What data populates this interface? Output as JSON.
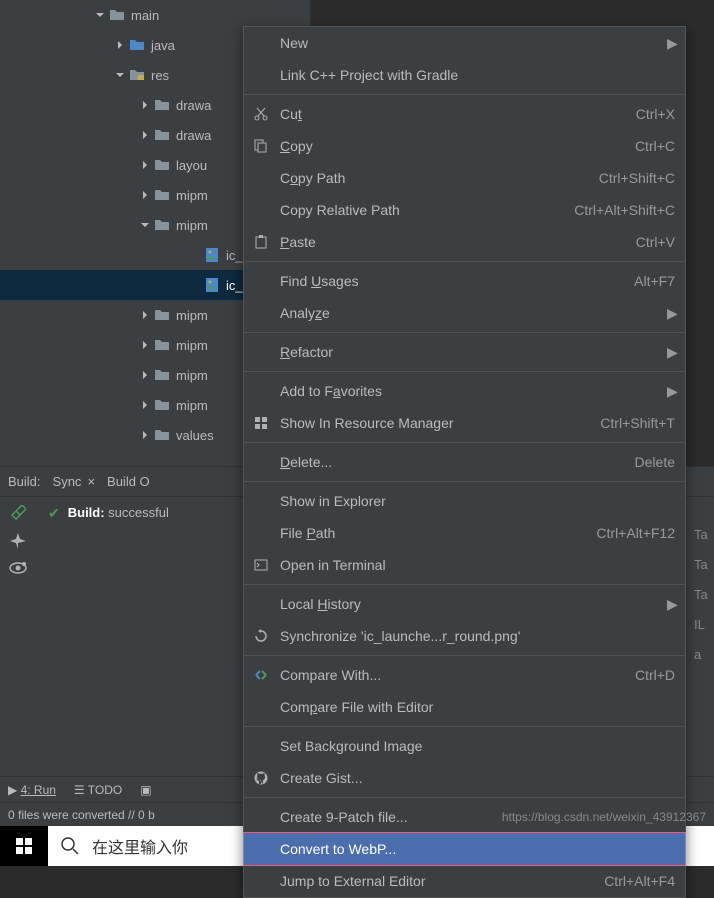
{
  "tree": {
    "items": [
      {
        "label": "main",
        "indent": "indent-1",
        "expanded": true,
        "type": "folder"
      },
      {
        "label": "java",
        "indent": "indent-2",
        "expanded": false,
        "type": "folder-blue"
      },
      {
        "label": "res",
        "indent": "indent-2",
        "expanded": true,
        "type": "folder-res"
      },
      {
        "label": "drawa",
        "indent": "indent-3",
        "expanded": false,
        "type": "folder"
      },
      {
        "label": "drawa",
        "indent": "indent-3",
        "expanded": false,
        "type": "folder"
      },
      {
        "label": "layou",
        "indent": "indent-3",
        "expanded": false,
        "type": "folder"
      },
      {
        "label": "mipm",
        "indent": "indent-3",
        "expanded": false,
        "type": "folder"
      },
      {
        "label": "mipm",
        "indent": "indent-3",
        "expanded": true,
        "type": "folder"
      },
      {
        "label": "ic_",
        "indent": "indent-5",
        "expanded": null,
        "type": "file"
      },
      {
        "label": "ic_",
        "indent": "indent-5",
        "expanded": null,
        "type": "file",
        "selected": true
      },
      {
        "label": "mipm",
        "indent": "indent-3",
        "expanded": false,
        "type": "folder"
      },
      {
        "label": "mipm",
        "indent": "indent-3",
        "expanded": false,
        "type": "folder"
      },
      {
        "label": "mipm",
        "indent": "indent-3",
        "expanded": false,
        "type": "folder"
      },
      {
        "label": "mipm",
        "indent": "indent-3",
        "expanded": false,
        "type": "folder"
      },
      {
        "label": "values",
        "indent": "indent-3",
        "expanded": false,
        "type": "folder"
      }
    ]
  },
  "build": {
    "label": "Build:",
    "tab": "Sync",
    "tab2": "Build O",
    "status_prefix": "Build:",
    "status_text": " successful"
  },
  "bottom_tabs": {
    "run": "4: Run",
    "todo": "TODO"
  },
  "status_bar": {
    "text": "0 files were converted // 0 b"
  },
  "taskbar": {
    "search_placeholder": "在这里输入你"
  },
  "context_menu": {
    "items": [
      {
        "label": "New",
        "icon": "",
        "shortcut": "",
        "arrow": true
      },
      {
        "label": "Link C++ Project with Gradle",
        "icon": "",
        "shortcut": ""
      },
      {
        "sep": true
      },
      {
        "label": "Cut",
        "mnemonic": "t",
        "raw": "Cu<u>t</u>",
        "icon": "cut",
        "shortcut": "Ctrl+X"
      },
      {
        "label": "Copy",
        "raw": "<u>C</u>opy",
        "icon": "copy",
        "shortcut": "Ctrl+C"
      },
      {
        "label": "Copy Path",
        "raw": "C<u>o</u>py Path",
        "icon": "",
        "shortcut": "Ctrl+Shift+C"
      },
      {
        "label": "Copy Relative Path",
        "icon": "",
        "shortcut": "Ctrl+Alt+Shift+C"
      },
      {
        "label": "Paste",
        "raw": "<u>P</u>aste",
        "icon": "paste",
        "shortcut": "Ctrl+V"
      },
      {
        "sep": true
      },
      {
        "label": "Find Usages",
        "raw": "Find <u>U</u>sages",
        "icon": "",
        "shortcut": "Alt+F7"
      },
      {
        "label": "Analyze",
        "raw": "Analy<u>z</u>e",
        "icon": "",
        "arrow": true
      },
      {
        "sep": true
      },
      {
        "label": "Refactor",
        "raw": "<u>R</u>efactor",
        "icon": "",
        "arrow": true
      },
      {
        "sep": true
      },
      {
        "label": "Add to Favorites",
        "raw": "Add to F<u>a</u>vorites",
        "icon": "",
        "arrow": true
      },
      {
        "label": "Show In Resource Manager",
        "icon": "res",
        "shortcut": "Ctrl+Shift+T"
      },
      {
        "sep": true
      },
      {
        "label": "Delete...",
        "raw": "<u>D</u>elete...",
        "icon": "",
        "shortcut": "Delete"
      },
      {
        "sep": true
      },
      {
        "label": "Show in Explorer",
        "icon": ""
      },
      {
        "label": "File Path",
        "raw": "File <u>P</u>ath",
        "icon": "",
        "shortcut": "Ctrl+Alt+F12"
      },
      {
        "label": "Open in Terminal",
        "icon": "term"
      },
      {
        "sep": true
      },
      {
        "label": "Local History",
        "raw": "Local <u>H</u>istory",
        "icon": "",
        "arrow": true
      },
      {
        "label": "Synchronize 'ic_launche...r_round.png'",
        "icon": "sync"
      },
      {
        "sep": true
      },
      {
        "label": "Compare With...",
        "icon": "diff",
        "shortcut": "Ctrl+D"
      },
      {
        "label": "Compare File with Editor",
        "raw": "Com<u>p</u>are File with Editor",
        "icon": ""
      },
      {
        "sep": true
      },
      {
        "label": "Set Background Image",
        "icon": ""
      },
      {
        "label": "Create Gist...",
        "icon": "github"
      },
      {
        "sep": true
      },
      {
        "label": "Create 9-Patch file...",
        "icon": ""
      },
      {
        "label": "Convert to WebP...",
        "icon": "",
        "selected": true
      },
      {
        "label": "Jump to External Editor",
        "icon": "",
        "shortcut": "Ctrl+Alt+F4"
      }
    ]
  },
  "right_fragments": [
    "Ta",
    "Ta",
    "Ta",
    "",
    "IL",
    "a"
  ],
  "watermark": "https://blog.csdn.net/weixin_43912367"
}
